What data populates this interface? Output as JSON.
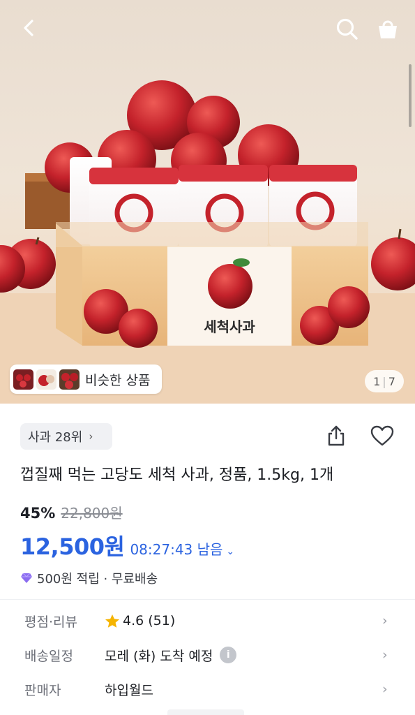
{
  "header": {
    "back_icon": "back-arrow-icon",
    "search_icon": "search-icon",
    "cart_icon": "shopping-bag-icon"
  },
  "gallery": {
    "box_label": "세척사과",
    "similar_label": "비슷한 상품",
    "image_index": "1",
    "image_total": "7"
  },
  "product": {
    "rank_chip": "사과 28위",
    "title": "껍질째 먹는 고당도 세척 사과, 정품, 1.5kg, 1개",
    "discount_rate": "45%",
    "original_price": "22,800원",
    "sale_price": "12,500원",
    "timer": "08:27:43 남음",
    "benefit": "500원 적립 · 무료배송"
  },
  "info_rows": {
    "rating_label": "평점·리뷰",
    "rating_value": "4.6 (51)",
    "delivery_label": "배송일정",
    "delivery_value": "모레 (화) 도착 예정",
    "seller_label": "판매자",
    "seller_value": "하입월드"
  },
  "colors": {
    "price_blue": "#2b63e0",
    "star_yellow": "#f5b400",
    "apple_red": "#c4222b"
  }
}
